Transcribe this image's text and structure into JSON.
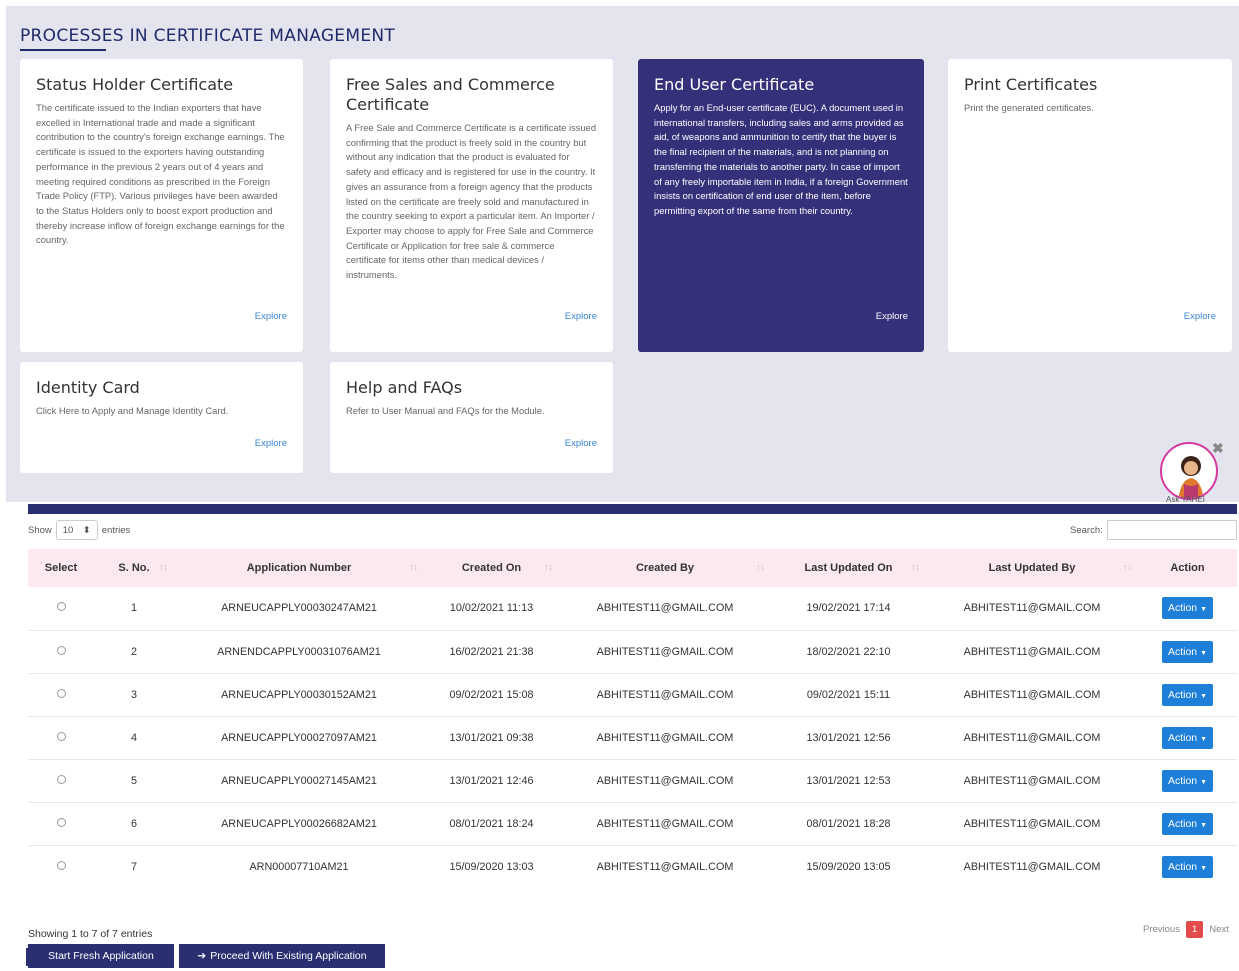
{
  "section": {
    "title": "PROCESSES IN CERTIFICATE MANAGEMENT"
  },
  "cards": [
    {
      "title": "Status Holder Certificate",
      "description": "The certificate issued to the Indian exporters that have excelled in International trade and made a significant contribution to the country's foreign exchange earnings. The certificate is issued to the exporters having outstanding performance in the previous 2 years out of 4 years and meeting required conditions as prescribed in the Foreign Trade Policy (FTP). Various privileges have been awarded to the Status Holders only to boost export production and thereby increase inflow of foreign exchange earnings for the country.",
      "link": "Explore"
    },
    {
      "title": "Free Sales and Commerce Certificate",
      "description": "A Free Sale and Commerce Certificate is a certificate issued confirming that the product is freely sold in the country but without any indication that the product is evaluated for safety and efficacy and is registered for use in the country. It gives an assurance from a foreign agency that the products listed on the certificate are freely sold and manufactured in the country seeking to export a particular item. An Importer / Exporter may choose to apply for Free Sale and Commerce Certificate or Application for free sale & commerce certificate for items other than medical devices / instruments.",
      "link": "Explore"
    },
    {
      "title": "End User Certificate",
      "description": "Apply for an End-user certificate (EUC). A document used in international transfers, including sales and arms provided as aid, of weapons and ammunition to certify that the buyer is the final recipient of the materials, and is not planning on transferring the materials to another party. In case of import of any freely importable item in India, if a foreign Government insists on certification of end user of the item, before permitting export of the same from their country.",
      "link": "Explore"
    },
    {
      "title": "Print Certificates",
      "description": "Print the generated certificates.",
      "link": "Explore"
    },
    {
      "title": "Identity Card",
      "description": "Click Here to Apply and Manage Identity Card.",
      "link": "Explore"
    },
    {
      "title": "Help and FAQs",
      "description": "Refer to User Manual and FAQs for the Module.",
      "link": "Explore"
    }
  ],
  "assistant": {
    "label": "Ask YAHEI",
    "close": "✖"
  },
  "table_controls": {
    "show_label": "Show",
    "entries_value": "10",
    "entries_label": "entries",
    "search_label": "Search:",
    "search_value": ""
  },
  "table": {
    "columns": [
      "Select",
      "S. No.",
      "Application Number",
      "Created On",
      "Created By",
      "Last Updated On",
      "Last Updated By",
      "Action"
    ],
    "rows": [
      {
        "sno": "1",
        "app": "ARNEUCAPPLY00030247AM21",
        "created_on": "10/02/2021 11:13",
        "created_by": "ABHITEST11@GMAIL.COM",
        "updated_on": "19/02/2021 17:14",
        "updated_by": "ABHITEST11@GMAIL.COM",
        "action": "Action"
      },
      {
        "sno": "2",
        "app": "ARNENDCAPPLY00031076AM21",
        "created_on": "16/02/2021 21:38",
        "created_by": "ABHITEST11@GMAIL.COM",
        "updated_on": "18/02/2021 22:10",
        "updated_by": "ABHITEST11@GMAIL.COM",
        "action": "Action"
      },
      {
        "sno": "3",
        "app": "ARNEUCAPPLY00030152AM21",
        "created_on": "09/02/2021 15:08",
        "created_by": "ABHITEST11@GMAIL.COM",
        "updated_on": "09/02/2021 15:11",
        "updated_by": "ABHITEST11@GMAIL.COM",
        "action": "Action"
      },
      {
        "sno": "4",
        "app": "ARNEUCAPPLY00027097AM21",
        "created_on": "13/01/2021 09:38",
        "created_by": "ABHITEST11@GMAIL.COM",
        "updated_on": "13/01/2021 12:56",
        "updated_by": "ABHITEST11@GMAIL.COM",
        "action": "Action"
      },
      {
        "sno": "5",
        "app": "ARNEUCAPPLY00027145AM21",
        "created_on": "13/01/2021 12:46",
        "created_by": "ABHITEST11@GMAIL.COM",
        "updated_on": "13/01/2021 12:53",
        "updated_by": "ABHITEST11@GMAIL.COM",
        "action": "Action"
      },
      {
        "sno": "6",
        "app": "ARNEUCAPPLY00026682AM21",
        "created_on": "08/01/2021 18:24",
        "created_by": "ABHITEST11@GMAIL.COM",
        "updated_on": "08/01/2021 18:28",
        "updated_by": "ABHITEST11@GMAIL.COM",
        "action": "Action"
      },
      {
        "sno": "7",
        "app": "ARN00007710AM21",
        "created_on": "15/09/2020 13:03",
        "created_by": "ABHITEST11@GMAIL.COM",
        "updated_on": "15/09/2020 13:05",
        "updated_by": "ABHITEST11@GMAIL.COM",
        "action": "Action"
      }
    ]
  },
  "footer": {
    "showing": "Showing 1 to 7 of 7 entries",
    "previous": "Previous",
    "page": "1",
    "next": "Next"
  },
  "buttons": {
    "fresh": "Start Fresh Application",
    "proceed": "Proceed With Existing Application"
  },
  "colors": {
    "navy": "#2a2f72",
    "active_card": "#34307a",
    "action_blue": "#1e7fd9",
    "header_pink": "#fbe9ee",
    "page_red": "#e34c4c"
  }
}
